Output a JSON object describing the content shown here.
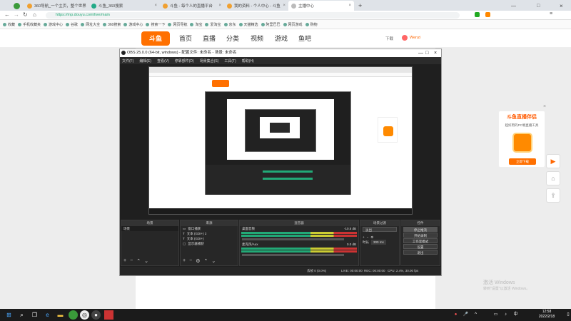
{
  "browser": {
    "tabs": [
      {
        "label": "360导航_一个主页，整个世界"
      },
      {
        "label": "斗鱼_360搜索"
      },
      {
        "label": "斗鱼 - 每个人的直播平台"
      },
      {
        "label": "我的资料 - 个人中心 - 斗鱼"
      },
      {
        "label": "主播中心",
        "active": true
      }
    ],
    "url": "https://mp.douyu.com/live/main",
    "bookmarks": [
      "收藏",
      "手机收藏夹",
      "游戏中心",
      "谷歌",
      "网址大全",
      "360搜索",
      "游戏中心",
      "搜索一下",
      "网页导航",
      "淘宝",
      "爱淘宝",
      "京东",
      "天猫精选",
      "阿里巴巴",
      "网页游戏",
      "购物"
    ]
  },
  "douyu": {
    "logo": "斗鱼",
    "nav": [
      "首页",
      "直播",
      "分类",
      "视频",
      "游戏",
      "鱼吧"
    ],
    "right": [
      "下载",
      "Wenzi"
    ]
  },
  "obs": {
    "title": "OBS 25.0.0 (64-bit, windows) - 配置文件: 未命名 - 场景: 未命名",
    "menu": [
      "文件(F)",
      "编辑(E)",
      "查看(V)",
      "停靠部件(D)",
      "场景集合(S)",
      "工具(T)",
      "帮助(H)"
    ],
    "panels": {
      "scenes": {
        "header": "场景",
        "items": [
          "场景"
        ]
      },
      "sources": {
        "header": "来源",
        "items": [
          "窗口捕获",
          "文本 (GDI+) 2",
          "文本 (GDI+)",
          "显示器捕获"
        ]
      },
      "mixer": {
        "header": "混音器",
        "tracks": [
          {
            "name": "桌面音频",
            "db": "-10.5 dB"
          },
          {
            "name": "麦克风/Aux",
            "db": "0.0 dB"
          }
        ]
      },
      "transitions": {
        "header": "场景过渡",
        "type": "淡出",
        "duration_label": "时长",
        "duration": "300 ms"
      },
      "controls": {
        "header": "控件",
        "buttons": [
          "停止推流",
          "开始录制",
          "工作室模式",
          "设置",
          "退出"
        ]
      }
    },
    "status": {
      "dropped": "丢帧 0 (0.0%)",
      "live": "LIVE: 00:00:00",
      "rec": "REC: 00:00:00",
      "cpu": "CPU: 2.4%, 30.00 fps"
    }
  },
  "promo": {
    "title": "斗鱼直播伴侣",
    "desc": "超好用的PC端直播工具",
    "btn": "立即下载"
  },
  "watermark": {
    "line1": "激活 Windows",
    "line2": "转到\"设置\"以激活 Windows。"
  },
  "taskbar": {
    "time": "12:58",
    "date": "2022/2/18"
  }
}
